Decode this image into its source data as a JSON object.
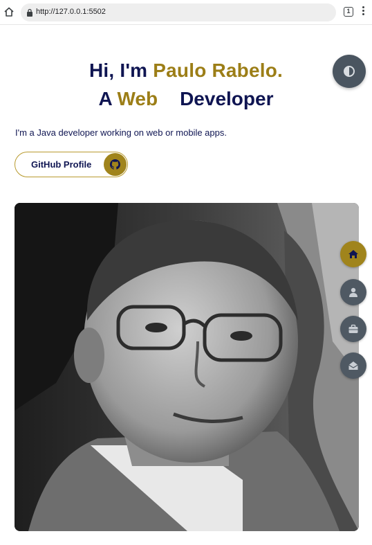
{
  "browser": {
    "url": "http://127.0.0.1:5502",
    "tab_count": "1"
  },
  "hero": {
    "greeting": "Hi, I'm ",
    "name": "Paulo Rabelo.",
    "role_prefix": "A ",
    "role_highlight": "Web",
    "role_suffix": "Developer",
    "intro": "I'm a Java developer working on web or mobile apps."
  },
  "buttons": {
    "github_label": "GitHub Profile"
  },
  "icons": {
    "theme": "half-circle-icon",
    "github": "github-icon",
    "nav": [
      "home-icon",
      "user-icon",
      "briefcase-icon",
      "envelope-open-icon"
    ]
  },
  "colors": {
    "primary": "#0f1552",
    "accent": "#9c7e17",
    "nav_inactive": "#4f5963",
    "theme_button": "#4a5560"
  }
}
